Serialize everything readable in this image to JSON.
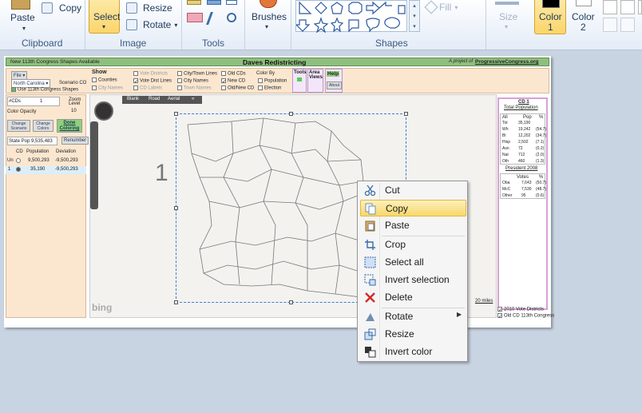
{
  "ribbon": {
    "paste": "Paste",
    "copy": "Copy",
    "select": "Select",
    "resize": "Resize",
    "rotate": "Rotate",
    "brushes": "Brushes",
    "fill": "Fill",
    "size": "Size",
    "color1": "Color\n1",
    "color1_a": "Color",
    "color1_b": "1",
    "color2_a": "Color",
    "color2_b": "2",
    "groups": [
      "Clipboard",
      "Image",
      "Tools",
      "Shapes"
    ]
  },
  "app": {
    "banner_left": "New 113th Congress Shapes Available",
    "title": "Daves Redistricting",
    "banner_right_prefix": "A project of",
    "banner_right_link": "ProgressiveCongress.org",
    "file": "File",
    "state": "North Carolina",
    "scenario": "Scenario CO",
    "use_113": "Use 113th Congress Shapes",
    "show": "Show",
    "show_items": [
      "Counties",
      "City Names",
      "Vote Districts",
      "Vote Dist Lines",
      "CD Labels",
      "City/Town Lines",
      "City Names",
      "Town Names",
      "Old CDs",
      "New CD",
      "Old/New CD"
    ],
    "color_by": "Color By",
    "color_by_items": [
      "Population",
      "Election"
    ],
    "tools": "Tools",
    "area_views": "Area Views",
    "help": "Help",
    "about": "About",
    "cds_label": "#CDs",
    "cds_value": "1",
    "zoom_label": "Zoom Level",
    "zoom_value": "10",
    "color_opacity": "Color Opacity",
    "change_scenario": "Change Scenario",
    "change_colors": "Change Colors",
    "done_coloring": "Done Coloring",
    "state_pop": "State Pop 9,535,483",
    "renumber": "Renumber",
    "table_headers": [
      "CD",
      "Population",
      "Deviation"
    ],
    "table_rows": [
      {
        "cd": "Un",
        "population": "9,500,293",
        "deviation": "-9,500,293"
      },
      {
        "cd": "1",
        "population": "35,190",
        "deviation": "-9,500,293"
      }
    ],
    "map_tabs": [
      "Blank",
      "Road",
      "Aerial"
    ],
    "district_label": "1",
    "bing": "bing",
    "scale": "20 miles",
    "cd_panel_title": "CD 1",
    "total_population": "Total Population",
    "pop_headers": [
      "All",
      "Pop",
      "%"
    ],
    "pop_rows": [
      [
        "Tot",
        "35,190",
        ""
      ],
      [
        "Wh",
        "19,242",
        "(54.7)"
      ],
      [
        "Bl",
        "12,202",
        "(34.7)"
      ],
      [
        "Hisp",
        "2,502",
        "(7.1)"
      ],
      [
        "Asn",
        "72",
        "(0.2)"
      ],
      [
        "Nat",
        "712",
        "(2.0)"
      ],
      [
        "Oth",
        "460",
        "(1.3)"
      ]
    ],
    "president": "President 2008",
    "vote_headers": [
      "Votes",
      "%"
    ],
    "vote_rows": [
      [
        "Oba",
        "7,643",
        "(50.7)"
      ],
      [
        "McC",
        "7,530",
        "(48.7)"
      ],
      [
        "Other",
        "95",
        "(0.6)"
      ]
    ],
    "bottom_checks": [
      "2010 Vote Districts",
      "Old CD 113th Congress"
    ]
  },
  "context_menu": {
    "items": [
      "Cut",
      "Copy",
      "Paste",
      "Crop",
      "Select all",
      "Invert selection",
      "Delete",
      "Rotate",
      "Resize",
      "Invert color"
    ],
    "highlighted": "Copy"
  }
}
